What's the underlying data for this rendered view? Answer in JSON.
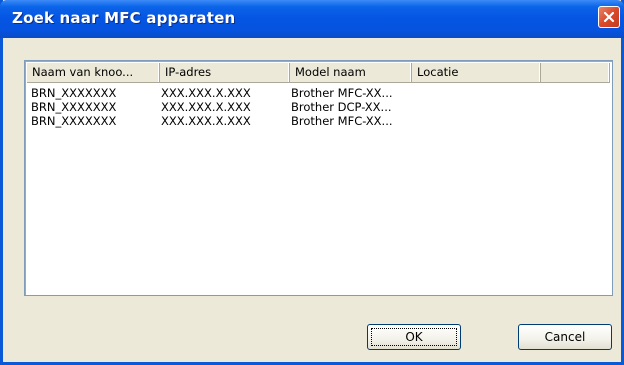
{
  "window": {
    "title": "Zoek naar MFC apparaten",
    "colors": {
      "titlebar": "#0554e3",
      "frame": "#0a5ad8",
      "face": "#ece9d8",
      "close": "#d9492a"
    }
  },
  "listview": {
    "columns": [
      "Naam van knoo...",
      "IP-adres",
      "Model naam",
      "Locatie",
      ""
    ],
    "rows": [
      [
        "BRN_XXXXXXX",
        "XXX.XXX.X.XXX",
        "Brother MFC-XX...",
        ""
      ],
      [
        "BRN_XXXXXXX",
        "XXX.XXX.X.XXX",
        "Brother DCP-XX...",
        ""
      ],
      [
        "BRN_XXXXXXX",
        "XXX.XXX.X.XXX",
        "Brother MFC-XX...",
        ""
      ]
    ]
  },
  "buttons": {
    "ok": "OK",
    "cancel": "Cancel"
  },
  "icons": {
    "close": "close-icon"
  }
}
